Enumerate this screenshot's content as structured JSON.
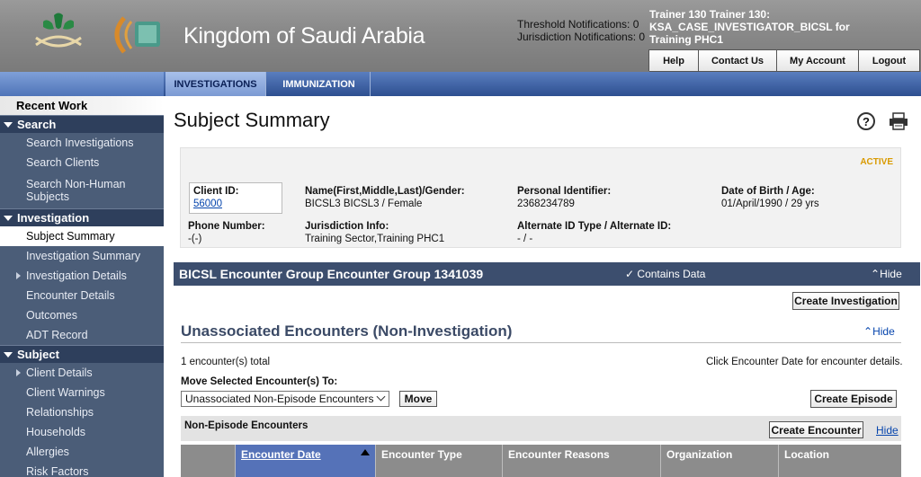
{
  "header": {
    "org_name": "Kingdom of Saudi Arabia",
    "threshold": "Threshold Notifications: 0",
    "jurisdiction": "Jurisdiction Notifications: 0",
    "user_line1": "Trainer 130 Trainer 130:",
    "user_line2": "KSA_CASE_INVESTIGATOR_BICSL for",
    "user_line3": "Training PHC1",
    "links": [
      "Help",
      "Contact Us",
      "My Account",
      "Logout"
    ]
  },
  "nav": {
    "tabs": [
      "INVESTIGATIONS",
      "IMMUNIZATION"
    ]
  },
  "sidebar": {
    "recent": "Recent Work",
    "search_title": "Search",
    "search_items": [
      "Search Investigations",
      "Search Clients",
      "Search Non-Human Subjects"
    ],
    "investigation_title": "Investigation",
    "investigation_items": [
      "Subject Summary",
      "Investigation Summary",
      "Investigation Details",
      "Encounter Details",
      "Outcomes",
      "ADT Record"
    ],
    "subject_title": "Subject",
    "subject_items": [
      "Client Details",
      "Client Warnings",
      "Relationships",
      "Households",
      "Allergies",
      "Risk Factors"
    ]
  },
  "main": {
    "title": "Subject Summary",
    "status": "ACTIVE",
    "client_id_label": "Client ID:",
    "client_id": "56000",
    "name_label": "Name(First,Middle,Last)/Gender:",
    "name_value": "BICSL3 BICSL3 / Female",
    "pid_label": "Personal Identifier:",
    "pid_value": "2368234789",
    "dob_label": "Date of Birth / Age:",
    "dob_value": "01/April/1990 / 29 yrs",
    "phone_label": "Phone Number:",
    "phone_value": "-(-)",
    "juris_label": "Jurisdiction Info:",
    "juris_value": "Training Sector,Training PHC1",
    "altid_label": "Alternate ID Type / Alternate ID:",
    "altid_value": "- / -",
    "encounter_group": "BICSL Encounter Group Encounter Group 1341039",
    "contains_data": "Contains Data",
    "hide": "Hide",
    "create_investigation": "Create Investigation",
    "unassoc_title": "Unassociated Encounters (Non-Investigation)",
    "total": "1 encounter(s) total",
    "click_hint": "Click Encounter Date for encounter details.",
    "move_label": "Move Selected Encounter(s) To:",
    "move_option": "Unassociated Non-Episode Encounters",
    "move_btn": "Move",
    "create_episode": "Create Episode",
    "non_episode": "Non-Episode Encounters",
    "create_encounter": "Create Encounter",
    "columns": [
      "Encounter Date",
      "Encounter Type",
      "Encounter Reasons",
      "Organization",
      "Location"
    ]
  }
}
